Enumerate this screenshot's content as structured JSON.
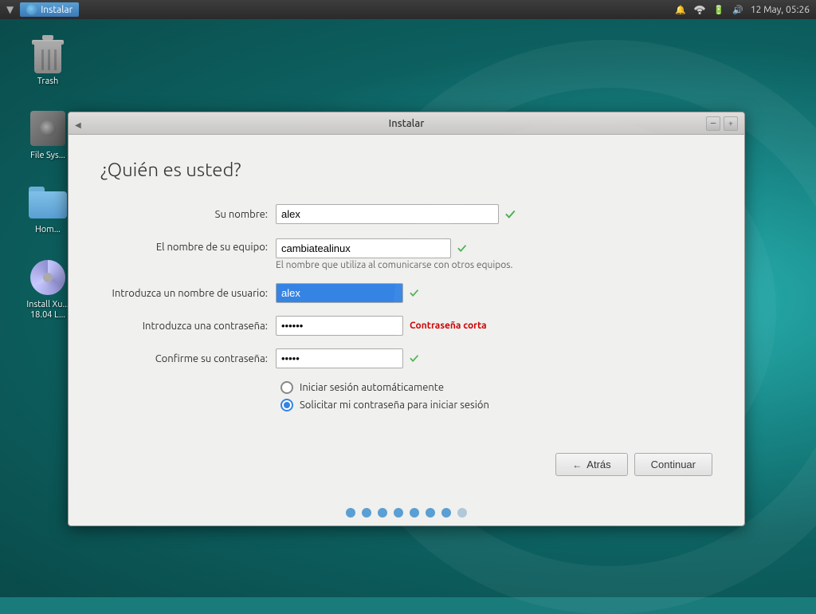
{
  "taskbar": {
    "app_label": "Instalar",
    "time": "12 May, 05:26"
  },
  "desktop": {
    "icons": [
      {
        "id": "trash",
        "label": "Trash"
      },
      {
        "id": "filesystem",
        "label": "File Sys..."
      },
      {
        "id": "home",
        "label": "Hom..."
      },
      {
        "id": "install",
        "label": "Install Xu...\n18.04 L..."
      }
    ]
  },
  "window": {
    "title": "Instalar",
    "page_heading": "¿Quién es usted?",
    "fields": {
      "nombre_label": "Su nombre:",
      "nombre_value": "alex",
      "equipo_label": "El nombre de su equipo:",
      "equipo_value": "cambiatealinux",
      "equipo_hint": "El nombre que utiliza al comunicarse con otros equipos.",
      "usuario_label": "Introduzca un nombre de usuario:",
      "usuario_value": "alex",
      "password_label": "Introduzca una contraseña:",
      "password_value": "••••••",
      "password_error": "Contraseña corta",
      "confirm_label": "Confirme su contraseña:",
      "confirm_value": "•••••",
      "radio_auto_label": "Iniciar sesión automáticamente",
      "radio_manual_label": "Solicitar mi contraseña para iniciar sesión"
    },
    "buttons": {
      "back": "← Atrás",
      "continue": "Continuar"
    }
  },
  "progress": {
    "total_dots": 8,
    "active_dots": [
      0,
      1,
      2,
      3,
      4,
      5,
      6
    ]
  }
}
